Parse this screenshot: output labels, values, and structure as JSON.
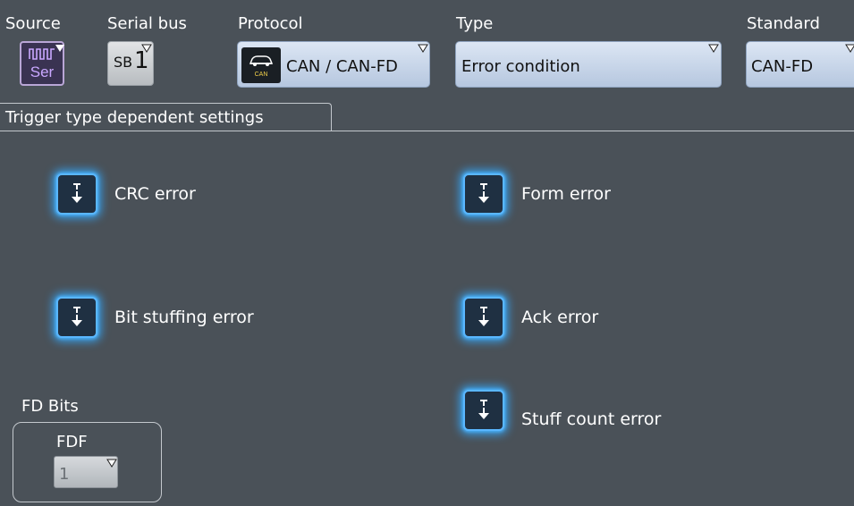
{
  "header": {
    "source_label": "Source",
    "source_button_text": "Ser",
    "serial_bus_label": "Serial bus",
    "serial_bus_prefix": "SB",
    "serial_bus_number": "1",
    "protocol_label": "Protocol",
    "protocol_value": "CAN / CAN-FD",
    "protocol_icon_text": "CAN",
    "type_label": "Type",
    "type_value": "Error condition",
    "standard_label": "Standard",
    "standard_value": "CAN-FD"
  },
  "section": {
    "title": "Trigger type dependent settings"
  },
  "errors": {
    "crc": "CRC error",
    "form": "Form error",
    "bit_stuffing": "Bit stuffing error",
    "ack": "Ack error",
    "stuff_count": "Stuff count error"
  },
  "fd_bits": {
    "title": "FD Bits",
    "fdf_label": "FDF",
    "fdf_value": "1"
  },
  "colors": {
    "background": "#4a5158",
    "accent_glow": "#34aaff",
    "combo_blue": "#c8d6ea",
    "source_purple": "#c9a7ff"
  }
}
